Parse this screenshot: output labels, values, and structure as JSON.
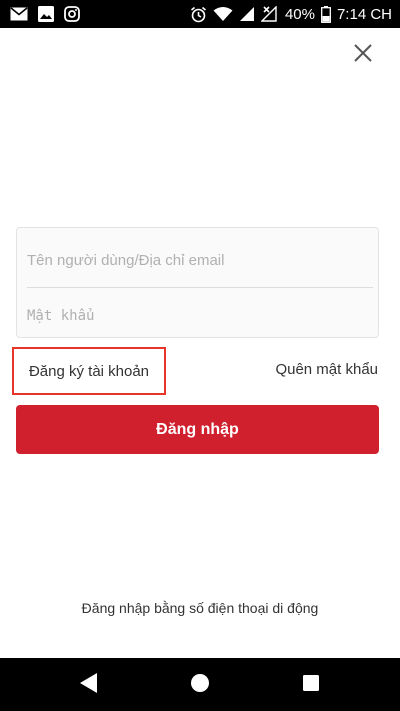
{
  "status_bar": {
    "battery_percent": "40%",
    "time": "7:14 CH",
    "notification_icons": [
      "mail-icon",
      "image-icon",
      "instagram-icon"
    ],
    "system_icons": [
      "alarm-icon",
      "wifi-icon",
      "signal-icon",
      "signal-x-icon",
      "battery-icon"
    ]
  },
  "login_form": {
    "username_placeholder": "Tên người dùng/Địa chỉ email",
    "password_placeholder": "Mật khẩu",
    "register_label": "Đăng ký tài khoản",
    "forgot_password_label": "Quên mật khẩu",
    "login_button_label": "Đăng nhập",
    "phone_login_label": "Đăng nhập bằng số điện thoại di động"
  },
  "colors": {
    "accent": "#d0202e",
    "highlight_border": "#e8352a",
    "text": "#333333",
    "placeholder": "#b0b0b0"
  },
  "nav_bar": {
    "buttons": [
      "back-icon",
      "home-icon",
      "recents-icon"
    ]
  }
}
